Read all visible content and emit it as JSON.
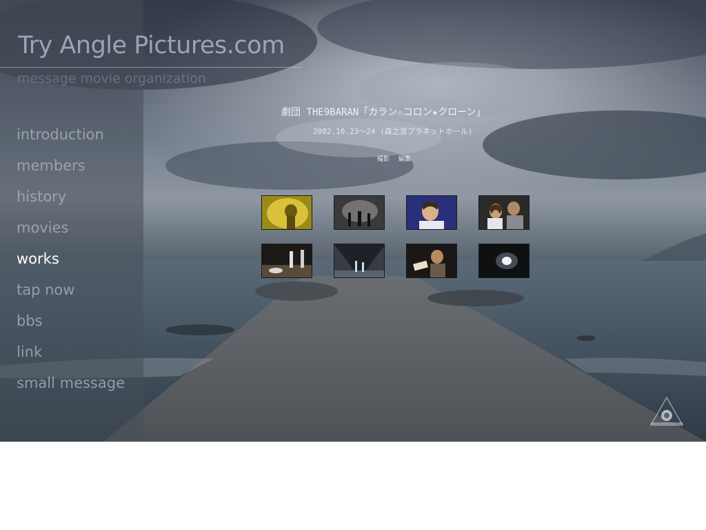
{
  "site": {
    "title": "Try Angle Pictures.com",
    "subtitle": "message movie organization"
  },
  "nav": {
    "items": [
      {
        "label": "introduction",
        "active": false
      },
      {
        "label": "members",
        "active": false
      },
      {
        "label": "history",
        "active": false
      },
      {
        "label": "movies",
        "active": false
      },
      {
        "label": "works",
        "active": true
      },
      {
        "label": "tap now",
        "active": false
      },
      {
        "label": "bbs",
        "active": false
      },
      {
        "label": "link",
        "active": false
      },
      {
        "label": "small message",
        "active": false
      }
    ]
  },
  "work": {
    "title": "劇団 THE9BARAN「カラン☆コロン★クローン」",
    "date": "2002.10.23～24 (森之宮プラネットホール)",
    "credits": [
      "撮影",
      "編集"
    ]
  },
  "thumbnails": [
    {
      "name": "thumbnail-yellow-stage"
    },
    {
      "name": "thumbnail-dark-silhouettes"
    },
    {
      "name": "thumbnail-woman-smiling"
    },
    {
      "name": "thumbnail-two-people"
    },
    {
      "name": "thumbnail-stage-group"
    },
    {
      "name": "thumbnail-stage-lights"
    },
    {
      "name": "thumbnail-person-reading"
    },
    {
      "name": "thumbnail-bright-light"
    }
  ],
  "colors": {
    "accent_active": "#ffffff",
    "nav_inactive": "#b0b6c2",
    "sidebar_overlay": "#464e5a"
  }
}
